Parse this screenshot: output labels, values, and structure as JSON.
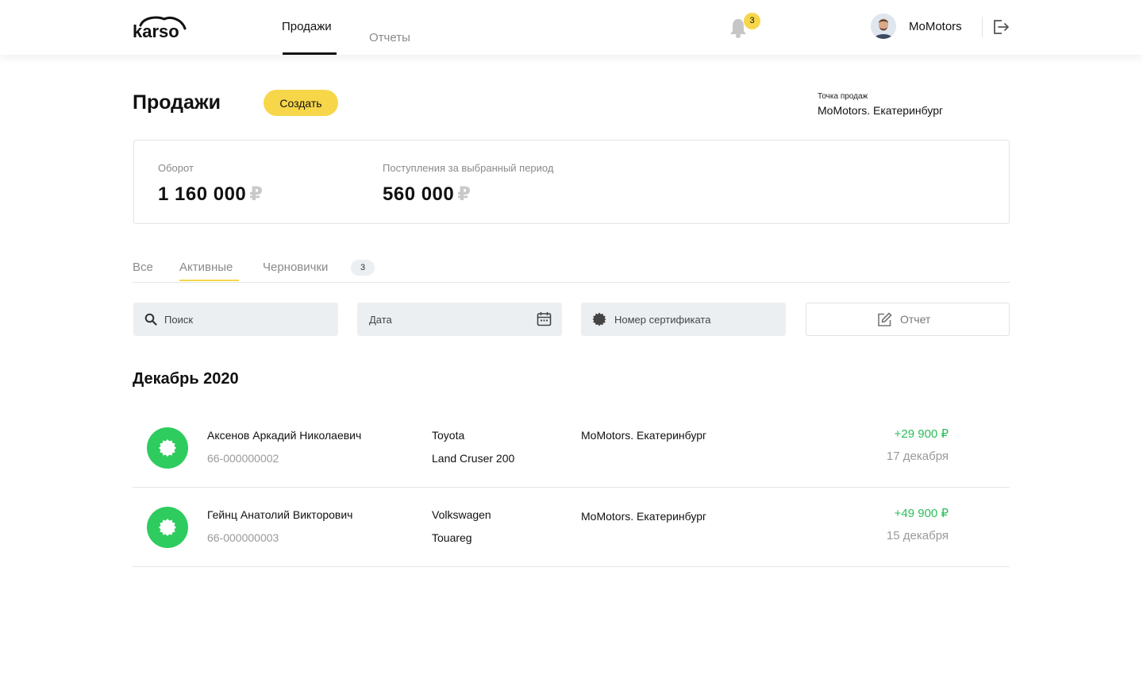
{
  "header": {
    "logo_text": "karso",
    "nav": {
      "sales": "Продажи",
      "reports": "Отчеты"
    },
    "notifications_count": "3",
    "user_name": "MoMotors"
  },
  "page": {
    "title": "Продажи",
    "create_label": "Создать",
    "point_of_sale_label": "Точка продаж",
    "point_of_sale_value": "MoMotors. Екатеринбург"
  },
  "stats": {
    "turnover_label": "Оборот",
    "turnover_value": "1 160 000",
    "income_label": "Поступления за выбранный период",
    "income_value": "560 000",
    "currency": "₽"
  },
  "tabs": {
    "all": "Все",
    "active": "Активные",
    "drafts": "Черновички",
    "drafts_count": "3"
  },
  "filters": {
    "search_placeholder": "Поиск",
    "date_placeholder": "Дата",
    "certificate_placeholder": "Номер сертификата",
    "report_label": "Отчет"
  },
  "month_title": "Декабрь 2020",
  "rows": [
    {
      "name": "Аксенов Аркадий Николаевич",
      "certificate": "66-000000002",
      "make": "Toyota",
      "model": "Land Cruser 200",
      "point": "MoMotors. Екатеринбург",
      "amount": "+29 900 ₽",
      "date": "17 декабря"
    },
    {
      "name": "Гейнц Анатолий Викторович",
      "certificate": "66-000000003",
      "make": "Volkswagen",
      "model": "Touareg",
      "point": "MoMotors. Екатеринбург",
      "amount": "+49 900 ₽",
      "date": "15 декабря"
    }
  ],
  "colors": {
    "accent": "#f7d64a",
    "success": "#2ecc5f",
    "muted": "#8a8a8a"
  }
}
